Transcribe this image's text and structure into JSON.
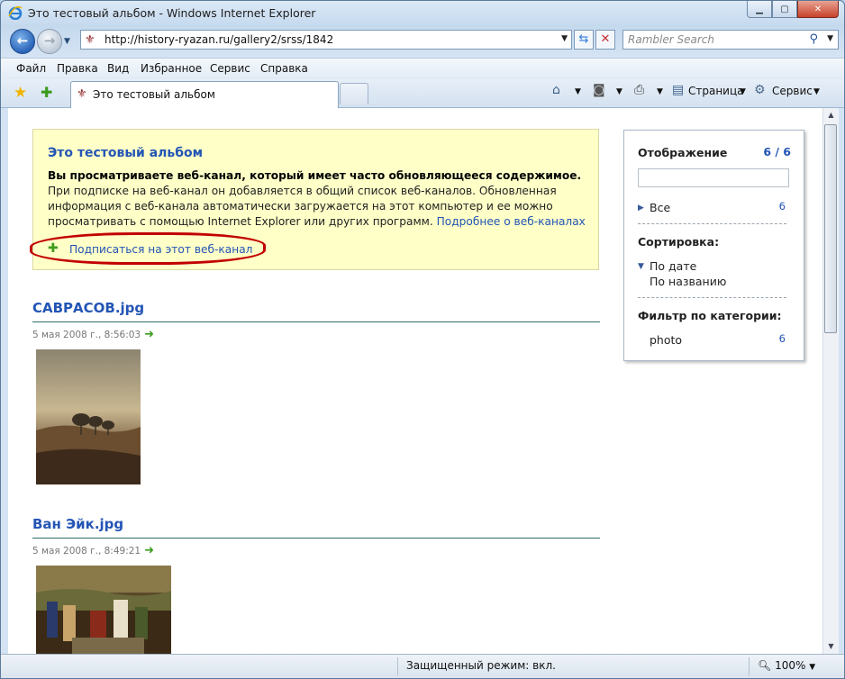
{
  "window": {
    "title": "Это тестовый альбом - Windows Internet Explorer",
    "address": "http://history-ryazan.ru/gallery2/srss/1842",
    "search_placeholder": "Rambler Search"
  },
  "menu": [
    "Файл",
    "Правка",
    "Вид",
    "Избранное",
    "Сервис",
    "Справка"
  ],
  "tab": {
    "label": "Это тестовый альбом"
  },
  "commands": {
    "page": "Страница",
    "tools": "Сервис"
  },
  "feed": {
    "title": "Это тестовый альбом",
    "bold_text": "Вы просматриваете веб-канал, который имеет часто обновляющееся содержимое.",
    "body_text": " При подписке на веб-канал он добавляется в общий список веб-каналов. Обновленная информация с веб-канала автоматически загружается на этот компьютер и ее можно просматривать с помощью Internet Explorer или других программ. ",
    "more_link": "Подробнее о веб-каналах",
    "subscribe": "Подписаться на этот веб-канал"
  },
  "entries": [
    {
      "title": "САВРАСОВ.jpg",
      "date": "5 мая 2008 г., 8:56:03"
    },
    {
      "title": "Ван Эйк.jpg",
      "date": "5 мая 2008 г., 8:49:21"
    }
  ],
  "sidebar": {
    "display_heading": "Отображение",
    "display_count": "6 / 6",
    "all_label": "Все",
    "all_count": "6",
    "sort_heading": "Сортировка:",
    "sort_date": "По дате",
    "sort_name": "По названию",
    "filter_heading": "Фильтр по категории:",
    "category": "photo",
    "category_count": "6"
  },
  "status": {
    "protected": "Защищенный режим: вкл.",
    "zoom": "100%"
  }
}
